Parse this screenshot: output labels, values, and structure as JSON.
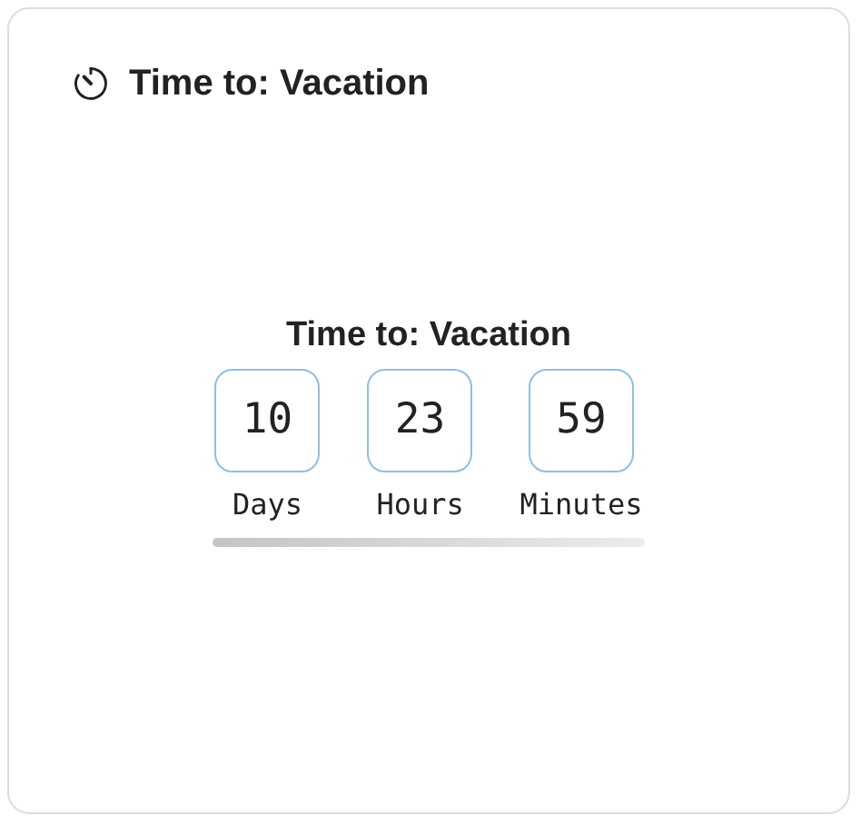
{
  "card": {
    "title": "Time to: Vacation"
  },
  "countdown": {
    "title": "Time to: Vacation",
    "units": [
      {
        "value": "10",
        "label": "Days"
      },
      {
        "value": "23",
        "label": "Hours"
      },
      {
        "value": "59",
        "label": "Minutes"
      }
    ]
  }
}
